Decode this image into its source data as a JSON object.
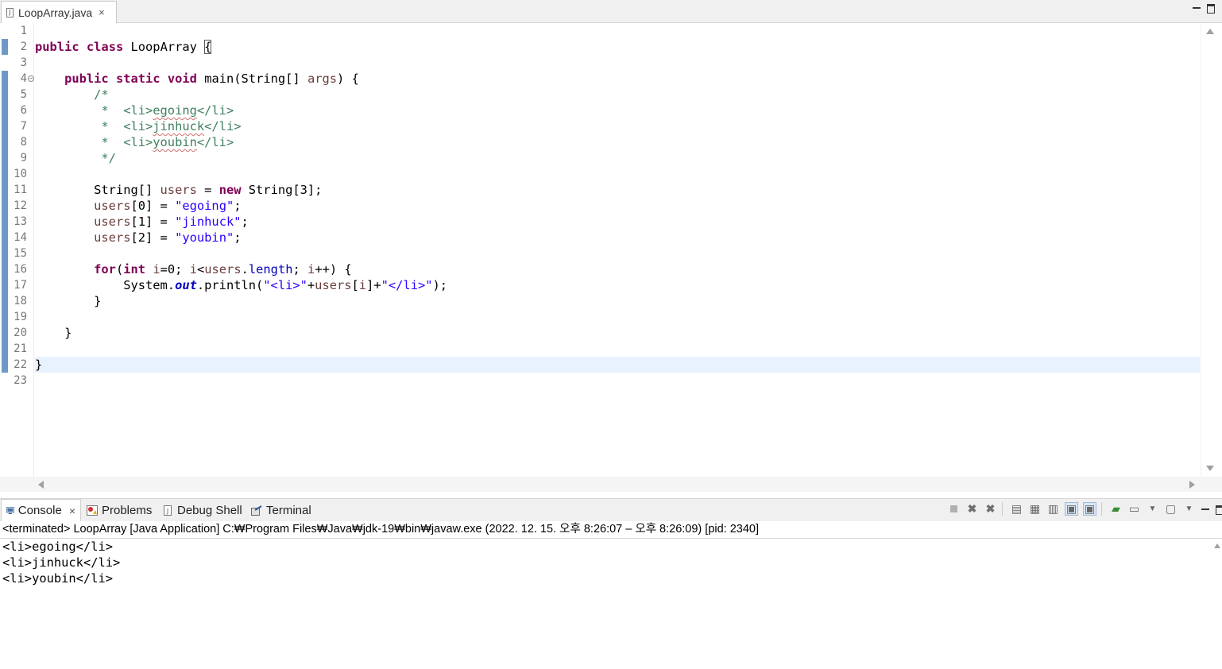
{
  "editor_tab": {
    "label": "LoopArray.java",
    "icon": "java-file-icon",
    "close": "×"
  },
  "line_numbers": [
    "1",
    "2",
    "3",
    "4",
    "5",
    "6",
    "7",
    "8",
    "9",
    "10",
    "11",
    "12",
    "13",
    "14",
    "15",
    "16",
    "17",
    "18",
    "19",
    "20",
    "21",
    "22",
    "23"
  ],
  "code": {
    "l2": {
      "kw1": "public",
      "kw2": "class",
      "name": " LoopArray ",
      "brace": "{"
    },
    "l4": {
      "indent": "    ",
      "kw1": "public",
      "kw2": "static",
      "kw3": "void",
      "sig": " main(String[] ",
      "param": "args",
      "tail": ") {"
    },
    "l5": "        /*",
    "l6": {
      "pre": "         *  <li>",
      "sq": "egoing",
      "post": "</li>"
    },
    "l7": {
      "pre": "         *  <li>",
      "sq": "jinhuck",
      "post": "</li>"
    },
    "l8": {
      "pre": "         *  <li>",
      "sq": "youbin",
      "post": "</li>"
    },
    "l9": "         */",
    "l11": {
      "pre": "        String[] ",
      "var": "users",
      "mid": " = ",
      "kw": "new",
      "post": " String[3];"
    },
    "l12": {
      "pre": "        ",
      "var": "users",
      "mid": "[0] = ",
      "str": "\"egoing\"",
      "post": ";"
    },
    "l13": {
      "pre": "        ",
      "var": "users",
      "mid": "[1] = ",
      "str": "\"jinhuck\"",
      "post": ";"
    },
    "l14": {
      "pre": "        ",
      "var": "users",
      "mid": "[2] = ",
      "str": "\"youbin\"",
      "post": ";"
    },
    "l16": {
      "pre": "        ",
      "kw1": "for",
      "p1": "(",
      "kw2": "int",
      "p2": " ",
      "v1": "i",
      "p3": "=0; ",
      "v2": "i",
      "p4": "<",
      "v3": "users",
      "p5": ".",
      "fld": "length",
      "p6": "; ",
      "v4": "i",
      "p7": "++) {"
    },
    "l17": {
      "pre": "            System.",
      "sfld": "out",
      "mid": ".println(",
      "s1": "\"<li>\"",
      "p1": "+",
      "v": "users",
      "p2": "[",
      "vi": "i",
      "p3": "]+",
      "s2": "\"</li>\"",
      "post": ");"
    },
    "l18": "        }",
    "l20": "    }",
    "l22": "}"
  },
  "console_tabs": [
    {
      "label": "Console",
      "icon": "console-icon"
    },
    {
      "label": "Problems",
      "icon": "problems-icon"
    },
    {
      "label": "Debug Shell",
      "icon": "debug-shell-icon"
    },
    {
      "label": "Terminal",
      "icon": "terminal-icon"
    }
  ],
  "console_tab_close": "×",
  "console_description": "<terminated> LoopArray [Java Application] C:₩Program Files₩Java₩jdk-19₩bin₩javaw.exe  (2022. 12. 15. 오후 8:26:07 – 오후 8:26:09) [pid: 2340]",
  "console_output": [
    "<li>egoing</li>",
    "<li>jinhuck</li>",
    "<li>youbin</li>"
  ],
  "colors": {
    "keyword": "#7f0055",
    "string": "#2a00ff",
    "field": "#0000c0",
    "comment": "#3f7f5f",
    "local_var": "#6a3e3e",
    "current_line": "#e8f2fe"
  }
}
